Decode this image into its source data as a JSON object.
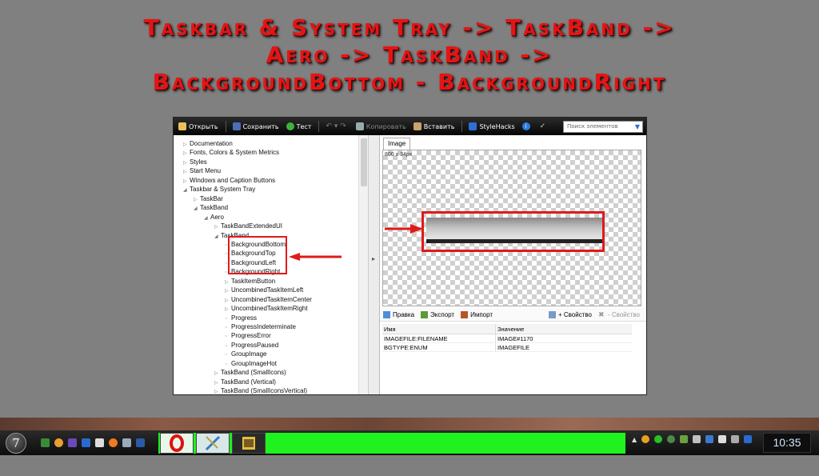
{
  "title": {
    "line1": "Taskbar & System Tray -> TaskBand ->",
    "line2": "Aero -> TaskBand ->",
    "line3": "BackgroundBottom - BackgroundRight"
  },
  "toolbar": {
    "open": "Открыть",
    "save": "Сохранить",
    "test": "Тест",
    "copy": "Копировать",
    "paste": "Вставить",
    "stylehacks": "StyleHacks",
    "search_placeholder": "Поиск элементов"
  },
  "tree": {
    "items": [
      {
        "label": "Documentation",
        "indent": 0,
        "tri": "▷"
      },
      {
        "label": "Fonts, Colors & System Metrics",
        "indent": 0,
        "tri": "▷"
      },
      {
        "label": "Styles",
        "indent": 0,
        "tri": "▷"
      },
      {
        "label": "Start Menu",
        "indent": 0,
        "tri": "▷"
      },
      {
        "label": "Windows and Caption Buttons",
        "indent": 0,
        "tri": "▷"
      },
      {
        "label": "Taskbar & System Tray",
        "indent": 0,
        "tri": "◢"
      },
      {
        "label": "TaskBar",
        "indent": 1,
        "tri": "▷"
      },
      {
        "label": "TaskBand",
        "indent": 1,
        "tri": "◢"
      },
      {
        "label": "Aero",
        "indent": 2,
        "tri": "◢"
      },
      {
        "label": "TaskBandExtendedUI",
        "indent": 3,
        "tri": "▷"
      },
      {
        "label": "TaskBand",
        "indent": 3,
        "tri": "◢"
      },
      {
        "label": "BackgroundBottom",
        "indent": 4,
        "tri": ""
      },
      {
        "label": "BackgroundTop",
        "indent": 4,
        "tri": ""
      },
      {
        "label": "BackgroundLeft",
        "indent": 4,
        "tri": ""
      },
      {
        "label": "BackgroundRight",
        "indent": 4,
        "tri": ""
      },
      {
        "label": "TaskItemButton",
        "indent": 4,
        "tri": "▷"
      },
      {
        "label": "UncombinedTaskItemLeft",
        "indent": 4,
        "tri": "▷"
      },
      {
        "label": "UncombinedTaskItemCenter",
        "indent": 4,
        "tri": "▷"
      },
      {
        "label": "UncombinedTaskItemRight",
        "indent": 4,
        "tri": "▷"
      },
      {
        "label": "Progress",
        "indent": 4,
        "tri": ""
      },
      {
        "label": "ProgressIndeterminate",
        "indent": 4,
        "tri": ""
      },
      {
        "label": "ProgressError",
        "indent": 4,
        "tri": ""
      },
      {
        "label": "ProgressPaused",
        "indent": 4,
        "tri": ""
      },
      {
        "label": "GroupImage",
        "indent": 4,
        "tri": ""
      },
      {
        "label": "GroupImageHot",
        "indent": 4,
        "tri": ""
      },
      {
        "label": "TaskBand (SmallIcons)",
        "indent": 3,
        "tri": "▷"
      },
      {
        "label": "TaskBand (Vertical)",
        "indent": 3,
        "tri": "▷"
      },
      {
        "label": "TaskBand (SmallIconsVertical)",
        "indent": 3,
        "tri": "▷"
      }
    ]
  },
  "image_panel": {
    "tab": "Image",
    "dims": "800 x 34px"
  },
  "props_toolbar": {
    "edit": "Правка",
    "export": "Экспорт",
    "import": "Импорт",
    "add_prop": "+ Свойство",
    "del_prop": "- Свойство"
  },
  "props_table": {
    "col_name": "Имя",
    "col_value": "Значение",
    "rows": [
      {
        "name": "IMAGEFILE:FILENAME",
        "value": "IMAGE#1170"
      },
      {
        "name": "BGTYPE:ENUM",
        "value": "IMAGEFILE"
      }
    ]
  },
  "taskbar": {
    "start_label": "7",
    "clock": "10:35",
    "band_color": "#1ff21f"
  }
}
